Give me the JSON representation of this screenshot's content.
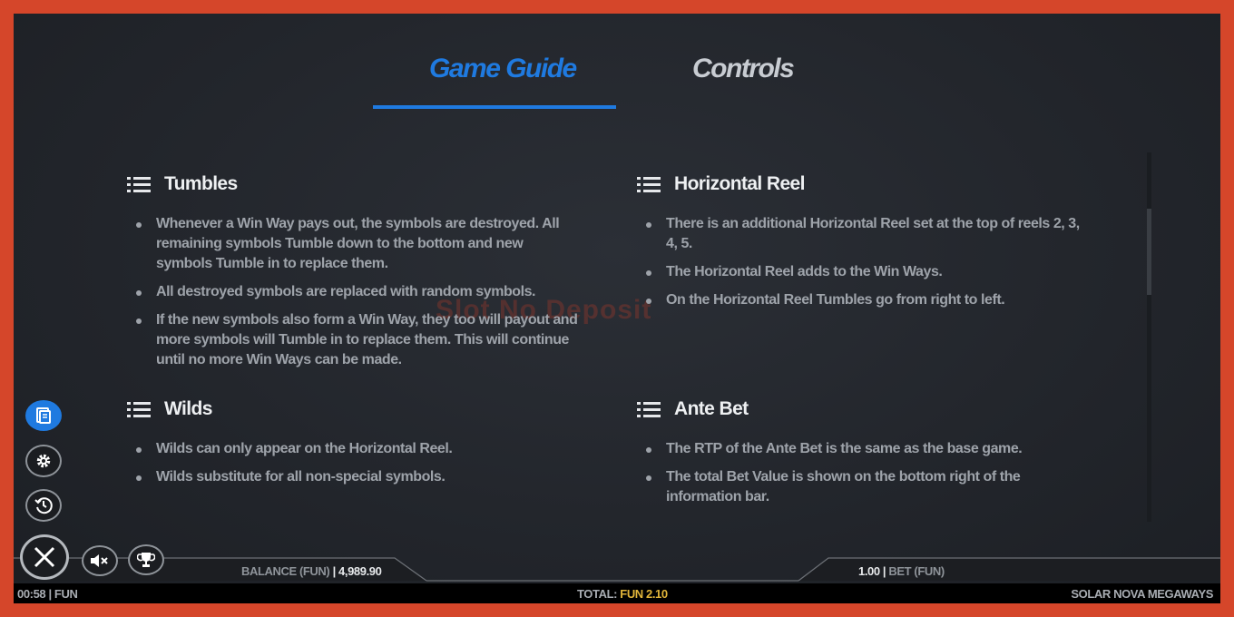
{
  "tabs": [
    {
      "label": "Game Guide",
      "active": true
    },
    {
      "label": "Controls",
      "active": false
    }
  ],
  "accent": "#1f7ae0",
  "sections": [
    {
      "title": "Tumbles",
      "items": [
        "Whenever a Win Way pays out, the symbols are destroyed. All remaining symbols Tumble down to the bottom and new symbols Tumble in to replace them.",
        "All destroyed symbols are replaced with random symbols.",
        "If the new symbols also form a Win Way, they too will payout and more symbols will Tumble in to replace them. This will continue until no more Win Ways can be made."
      ]
    },
    {
      "title": "Horizontal Reel",
      "items": [
        "There is an additional Horizontal Reel set at the top of reels 2, 3, 4, 5.",
        "The Horizontal Reel adds to the Win Ways.",
        "On the Horizontal Reel Tumbles go from right to left."
      ]
    },
    {
      "title": "Wilds",
      "items": [
        "Wilds can only appear on the Horizontal Reel.",
        "Wilds substitute for all non-special symbols."
      ]
    },
    {
      "title": "Ante Bet",
      "items": [
        "The RTP of the Ante Bet is the same as the base game.",
        "The total Bet Value is shown on the bottom right of the information bar."
      ]
    }
  ],
  "watermark": "Slot No Deposit",
  "side_icons": [
    "paytable-icon",
    "settings-gear-icon",
    "history-icon",
    "close-icon",
    "sound-muted-icon",
    "trophy-icon"
  ],
  "info": {
    "balance_label": "BALANCE (FUN)",
    "balance_value": "4,989.90",
    "bet_value": "1.00",
    "bet_label": "BET (FUN)"
  },
  "bottom": {
    "time": "00:58 | FUN",
    "total_label": "TOTAL:",
    "total_value": "FUN 2.10",
    "game_name": "SOLAR NOVA MEGAWAYS"
  }
}
